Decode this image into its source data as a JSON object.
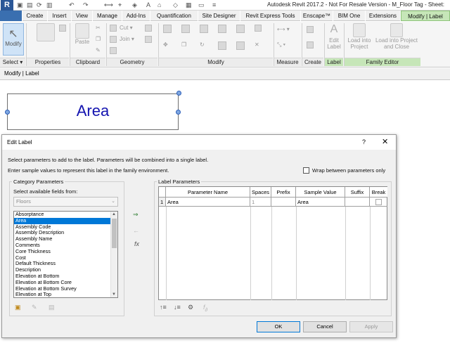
{
  "window": {
    "title": "Autodesk Revit 2017.2 -  Not For Resale Version -    M_Floor Tag - Sheet:",
    "app_icon": "R"
  },
  "tabs": [
    {
      "label": ""
    },
    {
      "label": "Create"
    },
    {
      "label": "Insert"
    },
    {
      "label": "View"
    },
    {
      "label": "Manage"
    },
    {
      "label": "Add-Ins"
    },
    {
      "label": "Quantification"
    },
    {
      "label": "Site Designer"
    },
    {
      "label": "Revit Express Tools"
    },
    {
      "label": "Enscape™"
    },
    {
      "label": "BIM One"
    },
    {
      "label": "Extensions"
    },
    {
      "label": "Modify | Label"
    }
  ],
  "ribbon": {
    "modify_label": "Modify",
    "paste_label": "Paste",
    "cut_label": "Cut",
    "join_label": "Join",
    "edit_label": "Edit Label",
    "load_project": "Load into Project",
    "load_close": "Load into Project and Close",
    "panels": {
      "select": "Select",
      "properties": "Properties",
      "clipboard": "Clipboard",
      "geometry": "Geometry",
      "modify": "Modify",
      "measure": "Measure",
      "create": "Create",
      "label": "Label",
      "family_editor": "Family Editor"
    }
  },
  "options_bar": {
    "context": "Modify | Label"
  },
  "canvas": {
    "label_text": "Area"
  },
  "dialog": {
    "title": "Edit Label",
    "help": "?",
    "close": "✕",
    "instruction1": "Select parameters to add to the label.  Parameters will be combined into a single label.",
    "instruction2": "Enter sample values to represent this label in the family environment.",
    "wrap_label": "Wrap between parameters only",
    "category_group": "Category Parameters",
    "select_fields": "Select available fields from:",
    "category_value": "Floors",
    "fields": [
      "Absorptance",
      "Area",
      "Assembly Code",
      "Assembly Description",
      "Assembly Name",
      "Comments",
      "Core Thickness",
      "Cost",
      "Default Thickness",
      "Description",
      "Elevation at Bottom",
      "Elevation at Bottom Core",
      "Elevation at Bottom Survey",
      "Elevation at Top"
    ],
    "selected_field": "Area",
    "label_group": "Label Parameters",
    "columns": [
      "",
      "Parameter Name",
      "Spaces",
      "Prefix",
      "Sample Value",
      "Suffix",
      "Break"
    ],
    "rows": [
      {
        "num": "1",
        "name": "Area",
        "spaces": "1",
        "prefix": "",
        "sample": "Area",
        "suffix": ""
      }
    ],
    "fx_label": "fx",
    "buttons": {
      "ok": "OK",
      "cancel": "Cancel",
      "apply": "Apply"
    }
  }
}
